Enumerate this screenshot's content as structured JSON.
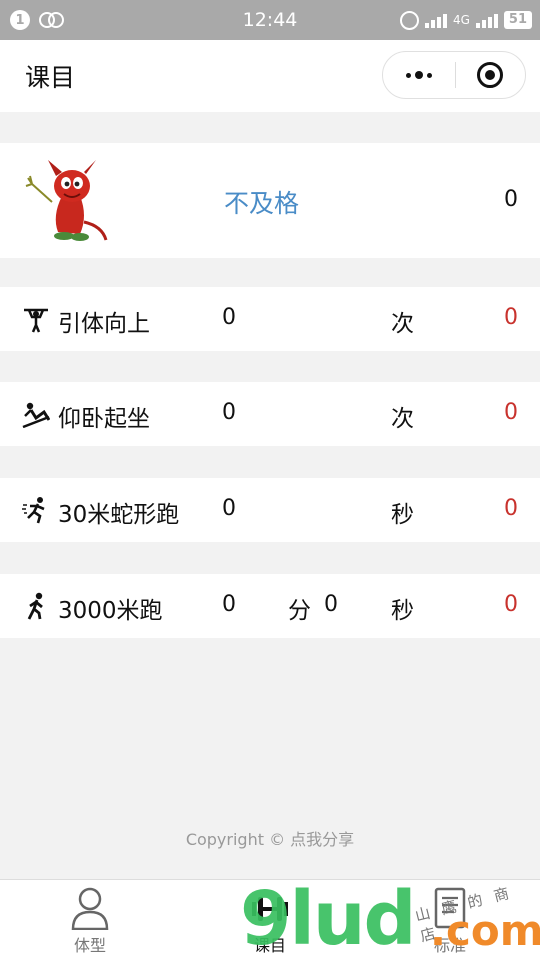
{
  "status_bar": {
    "notif_count": "1",
    "time": "12:44",
    "network": "4G",
    "battery": "51"
  },
  "nav": {
    "title": "课目"
  },
  "summary": {
    "grade": "不及格",
    "score": "0"
  },
  "events": [
    {
      "name": "引体向上",
      "value": "0",
      "unit": "次",
      "points": "0",
      "icon": "pull-up-icon"
    },
    {
      "name": "仰卧起坐",
      "value": "0",
      "unit": "次",
      "points": "0",
      "icon": "sit-up-icon"
    },
    {
      "name": "30米蛇形跑",
      "value": "0",
      "unit": "秒",
      "points": "0",
      "icon": "sprint-icon"
    },
    {
      "name": "3000米跑",
      "value": "0",
      "mid_unit": "分",
      "value2": "0",
      "unit": "秒",
      "points": "0",
      "icon": "runner-icon"
    }
  ],
  "footer": {
    "copyright": "Copyright © 点我分享"
  },
  "tabs": [
    {
      "label": "体型",
      "icon": "person-icon"
    },
    {
      "label": "课目",
      "icon": "dumbbell-icon"
    },
    {
      "label": "标准",
      "icon": "document-icon"
    }
  ],
  "watermark": {
    "brand": "9lud",
    "suffix": ".com",
    "handwriting": "山鹰的商店"
  },
  "colors": {
    "grade": "#4a8cc7",
    "points": "#c8322d",
    "status_bar": "#a9a9a9",
    "background": "#f2f2f2"
  }
}
